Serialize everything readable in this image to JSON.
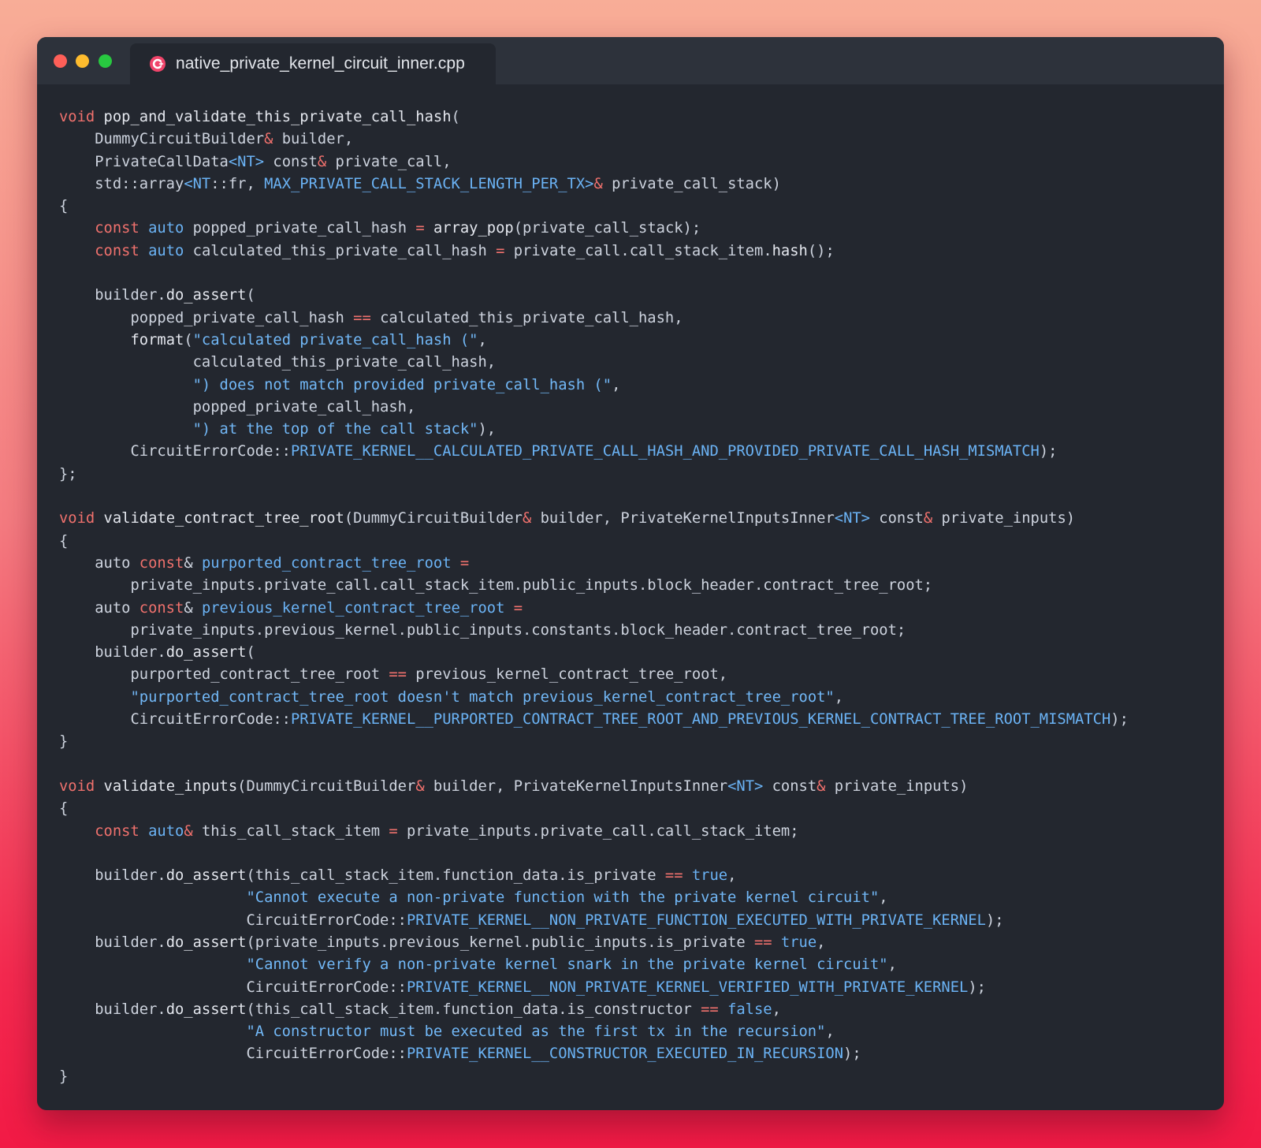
{
  "window": {
    "tab_title": "native_private_kernel_circuit_inner.cpp",
    "tab_icon": "cpp-file-icon",
    "traffic_lights": [
      "close",
      "minimize",
      "maximize"
    ]
  },
  "colors": {
    "keyword": "#f0716d",
    "type": "#6bb3f5",
    "string": "#72b8f7",
    "identifier": "#cdd3de",
    "background": "#23272f",
    "titlebar": "#2d323b"
  },
  "code": {
    "language": "cpp",
    "lines": [
      [
        [
          "kw",
          "void"
        ],
        [
          "id",
          " "
        ],
        [
          "fn",
          "pop_and_validate_this_private_call_hash"
        ],
        [
          "id",
          "("
        ]
      ],
      [
        [
          "id",
          "    DummyCircuitBuilder"
        ],
        [
          "op",
          "&"
        ],
        [
          "id",
          " builder,"
        ]
      ],
      [
        [
          "id",
          "    PrivateCallData"
        ],
        [
          "ty",
          "<NT>"
        ],
        [
          "id",
          " const"
        ],
        [
          "op",
          "&"
        ],
        [
          "id",
          " private_call,"
        ]
      ],
      [
        [
          "id",
          "    std::array"
        ],
        [
          "ty",
          "<NT"
        ],
        [
          "id",
          "::fr, "
        ],
        [
          "ty",
          "MAX_PRIVATE_CALL_STACK_LENGTH_PER_TX>"
        ],
        [
          "op",
          "&"
        ],
        [
          "id",
          " private_call_stack)"
        ]
      ],
      [
        [
          "id",
          "{"
        ]
      ],
      [
        [
          "id",
          "    "
        ],
        [
          "kw",
          "const"
        ],
        [
          "id",
          " "
        ],
        [
          "ty",
          "auto"
        ],
        [
          "id",
          " popped_private_call_hash "
        ],
        [
          "op",
          "="
        ],
        [
          "id",
          " "
        ],
        [
          "fn",
          "array_pop"
        ],
        [
          "id",
          "(private_call_stack);"
        ]
      ],
      [
        [
          "id",
          "    "
        ],
        [
          "kw",
          "const"
        ],
        [
          "id",
          " "
        ],
        [
          "ty",
          "auto"
        ],
        [
          "id",
          " calculated_this_private_call_hash "
        ],
        [
          "op",
          "="
        ],
        [
          "id",
          " private_call.call_stack_item."
        ],
        [
          "fn",
          "hash"
        ],
        [
          "id",
          "();"
        ]
      ],
      [
        [
          "id",
          ""
        ]
      ],
      [
        [
          "id",
          "    builder."
        ],
        [
          "fn",
          "do_assert"
        ],
        [
          "id",
          "("
        ]
      ],
      [
        [
          "id",
          "        popped_private_call_hash "
        ],
        [
          "op",
          "=="
        ],
        [
          "id",
          " calculated_this_private_call_hash,"
        ]
      ],
      [
        [
          "id",
          "        "
        ],
        [
          "fn",
          "format"
        ],
        [
          "id",
          "("
        ],
        [
          "str",
          "\"calculated private_call_hash (\""
        ],
        [
          "id",
          ","
        ]
      ],
      [
        [
          "id",
          "               calculated_this_private_call_hash,"
        ]
      ],
      [
        [
          "id",
          "               "
        ],
        [
          "str",
          "\") does not match provided private_call_hash (\""
        ],
        [
          "id",
          ","
        ]
      ],
      [
        [
          "id",
          "               popped_private_call_hash,"
        ]
      ],
      [
        [
          "id",
          "               "
        ],
        [
          "str",
          "\") at the top of the call stack\""
        ],
        [
          "id",
          "),"
        ]
      ],
      [
        [
          "id",
          "        CircuitErrorCode::"
        ],
        [
          "ty",
          "PRIVATE_KERNEL__CALCULATED_PRIVATE_CALL_HASH_AND_PROVIDED_PRIVATE_CALL_HASH_MISMATCH"
        ],
        [
          "id",
          ");"
        ]
      ],
      [
        [
          "id",
          "};"
        ]
      ],
      [
        [
          "id",
          ""
        ]
      ],
      [
        [
          "kw",
          "void"
        ],
        [
          "id",
          " "
        ],
        [
          "fn",
          "validate_contract_tree_root"
        ],
        [
          "id",
          "(DummyCircuitBuilder"
        ],
        [
          "op",
          "&"
        ],
        [
          "id",
          " builder, PrivateKernelInputsInner"
        ],
        [
          "ty",
          "<NT>"
        ],
        [
          "id",
          " const"
        ],
        [
          "op",
          "&"
        ],
        [
          "id",
          " private_inputs)"
        ]
      ],
      [
        [
          "id",
          "{"
        ]
      ],
      [
        [
          "id",
          "    auto "
        ],
        [
          "kw",
          "const"
        ],
        [
          "id",
          "& "
        ],
        [
          "ty",
          "purported_contract_tree_root"
        ],
        [
          "id",
          " "
        ],
        [
          "op",
          "="
        ]
      ],
      [
        [
          "id",
          "        private_inputs.private_call.call_stack_item.public_inputs.block_header.contract_tree_root;"
        ]
      ],
      [
        [
          "id",
          "    auto "
        ],
        [
          "kw",
          "const"
        ],
        [
          "id",
          "& "
        ],
        [
          "ty",
          "previous_kernel_contract_tree_root"
        ],
        [
          "id",
          " "
        ],
        [
          "op",
          "="
        ]
      ],
      [
        [
          "id",
          "        private_inputs.previous_kernel.public_inputs.constants.block_header.contract_tree_root;"
        ]
      ],
      [
        [
          "id",
          "    builder."
        ],
        [
          "fn",
          "do_assert"
        ],
        [
          "id",
          "("
        ]
      ],
      [
        [
          "id",
          "        purported_contract_tree_root "
        ],
        [
          "op",
          "=="
        ],
        [
          "id",
          " previous_kernel_contract_tree_root,"
        ]
      ],
      [
        [
          "id",
          "        "
        ],
        [
          "str",
          "\"purported_contract_tree_root doesn't match previous_kernel_contract_tree_root\""
        ],
        [
          "id",
          ","
        ]
      ],
      [
        [
          "id",
          "        CircuitErrorCode::"
        ],
        [
          "ty",
          "PRIVATE_KERNEL__PURPORTED_CONTRACT_TREE_ROOT_AND_PREVIOUS_KERNEL_CONTRACT_TREE_ROOT_MISMATCH"
        ],
        [
          "id",
          ");"
        ]
      ],
      [
        [
          "id",
          "}"
        ]
      ],
      [
        [
          "id",
          ""
        ]
      ],
      [
        [
          "kw",
          "void"
        ],
        [
          "id",
          " "
        ],
        [
          "fn",
          "validate_inputs"
        ],
        [
          "id",
          "(DummyCircuitBuilder"
        ],
        [
          "op",
          "&"
        ],
        [
          "id",
          " builder, PrivateKernelInputsInner"
        ],
        [
          "ty",
          "<NT>"
        ],
        [
          "id",
          " const"
        ],
        [
          "op",
          "&"
        ],
        [
          "id",
          " private_inputs)"
        ]
      ],
      [
        [
          "id",
          "{"
        ]
      ],
      [
        [
          "id",
          "    "
        ],
        [
          "kw",
          "const"
        ],
        [
          "id",
          " "
        ],
        [
          "ty",
          "auto"
        ],
        [
          "op",
          "&"
        ],
        [
          "id",
          " this_call_stack_item "
        ],
        [
          "op",
          "="
        ],
        [
          "id",
          " private_inputs.private_call.call_stack_item;"
        ]
      ],
      [
        [
          "id",
          ""
        ]
      ],
      [
        [
          "id",
          "    builder."
        ],
        [
          "fn",
          "do_assert"
        ],
        [
          "id",
          "(this_call_stack_item.function_data.is_private "
        ],
        [
          "op",
          "=="
        ],
        [
          "id",
          " "
        ],
        [
          "ty",
          "true"
        ],
        [
          "id",
          ","
        ]
      ],
      [
        [
          "id",
          "                     "
        ],
        [
          "str",
          "\"Cannot execute a non-private function with the private kernel circuit\""
        ],
        [
          "id",
          ","
        ]
      ],
      [
        [
          "id",
          "                     CircuitErrorCode::"
        ],
        [
          "ty",
          "PRIVATE_KERNEL__NON_PRIVATE_FUNCTION_EXECUTED_WITH_PRIVATE_KERNEL"
        ],
        [
          "id",
          ");"
        ]
      ],
      [
        [
          "id",
          "    builder."
        ],
        [
          "fn",
          "do_assert"
        ],
        [
          "id",
          "(private_inputs.previous_kernel.public_inputs.is_private "
        ],
        [
          "op",
          "=="
        ],
        [
          "id",
          " "
        ],
        [
          "ty",
          "true"
        ],
        [
          "id",
          ","
        ]
      ],
      [
        [
          "id",
          "                     "
        ],
        [
          "str",
          "\"Cannot verify a non-private kernel snark in the private kernel circuit\""
        ],
        [
          "id",
          ","
        ]
      ],
      [
        [
          "id",
          "                     CircuitErrorCode::"
        ],
        [
          "ty",
          "PRIVATE_KERNEL__NON_PRIVATE_KERNEL_VERIFIED_WITH_PRIVATE_KERNEL"
        ],
        [
          "id",
          ");"
        ]
      ],
      [
        [
          "id",
          "    builder."
        ],
        [
          "fn",
          "do_assert"
        ],
        [
          "id",
          "(this_call_stack_item.function_data.is_constructor "
        ],
        [
          "op",
          "=="
        ],
        [
          "id",
          " "
        ],
        [
          "ty",
          "false"
        ],
        [
          "id",
          ","
        ]
      ],
      [
        [
          "id",
          "                     "
        ],
        [
          "str",
          "\"A constructor must be executed as the first tx in the recursion\""
        ],
        [
          "id",
          ","
        ]
      ],
      [
        [
          "id",
          "                     CircuitErrorCode::"
        ],
        [
          "ty",
          "PRIVATE_KERNEL__CONSTRUCTOR_EXECUTED_IN_RECURSION"
        ],
        [
          "id",
          ");"
        ]
      ],
      [
        [
          "id",
          "}"
        ]
      ]
    ]
  }
}
